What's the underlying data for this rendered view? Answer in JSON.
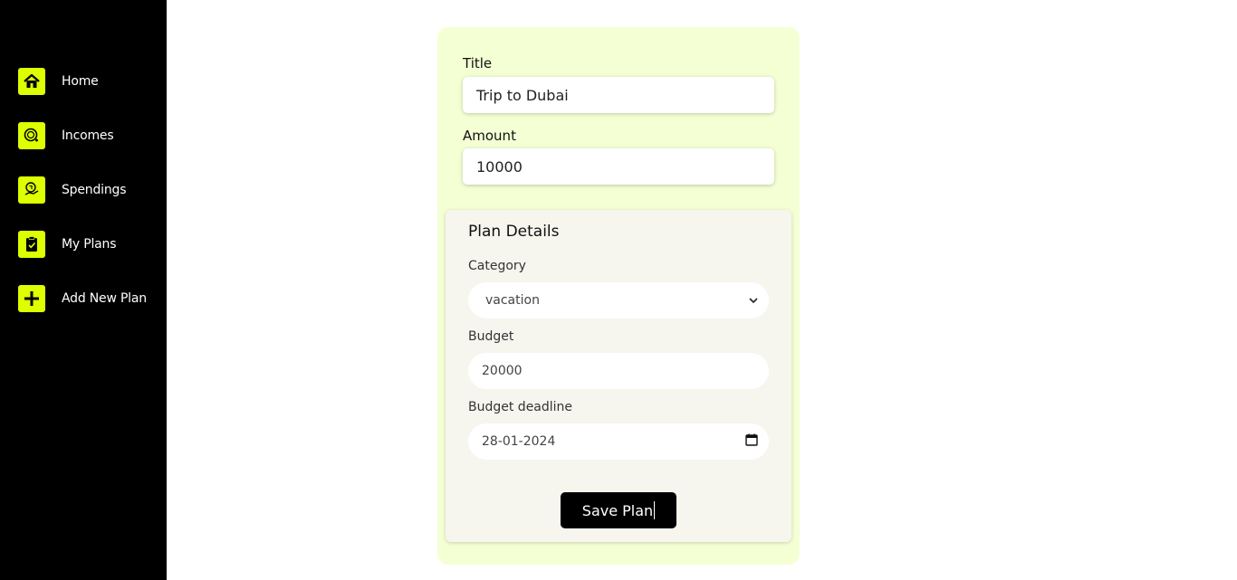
{
  "sidebar": {
    "items": [
      {
        "label": "Home",
        "icon": "home-icon"
      },
      {
        "label": "Incomes",
        "icon": "income-coin-icon"
      },
      {
        "label": "Spendings",
        "icon": "spending-hand-icon"
      },
      {
        "label": "My Plans",
        "icon": "clipboard-check-icon"
      },
      {
        "label": "Add New Plan",
        "icon": "plus-icon"
      }
    ]
  },
  "form": {
    "title_label": "Title",
    "title_value": "Trip to Dubai",
    "amount_label": "Amount",
    "amount_value": "10000",
    "details": {
      "heading": "Plan Details",
      "category_label": "Category",
      "category_value": "vacation",
      "budget_label": "Budget",
      "budget_value": "20000",
      "deadline_label": "Budget deadline",
      "deadline_value": "28-01-2024"
    },
    "save_label": "Save Plan"
  },
  "colors": {
    "accent": "#ddff00",
    "sidebar_bg": "#000000",
    "card_bg": "#f4ffd4",
    "details_bg": "#f6f6ef"
  }
}
